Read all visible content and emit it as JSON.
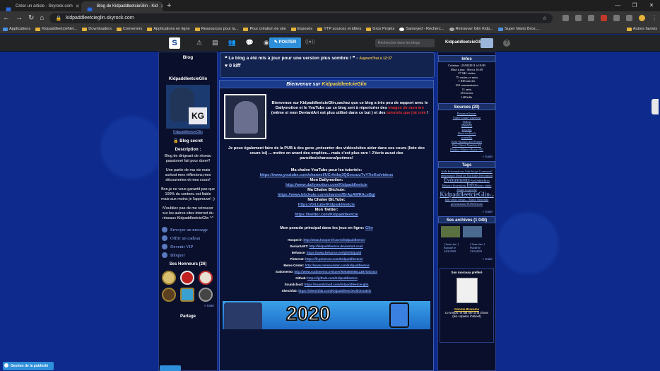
{
  "browser": {
    "tabs": [
      {
        "title": "Créer un article - Skyrock.com",
        "active": false
      },
      {
        "title": "Blog de KidpaddleetcieGlin - Kid",
        "active": true
      }
    ],
    "url": "kidpaddleetcieglin.skyrock.com",
    "bookmarks": [
      "Applications",
      "KidpaddleetcieNet...",
      "Downloaders",
      "Converters",
      "Applications en ligne",
      "Ressources pour la...",
      "Pour création de site",
      "Exposés",
      "YTP sources et idées",
      "Gros Projets",
      "Samoyed - Recherc...",
      "Retrouver Glin Kidp...",
      "Super Mario Bros:..."
    ],
    "bookmarks_right": "Autres favoris"
  },
  "skyrock": {
    "logo": "S",
    "poster": "POSTER",
    "search_placeholder": "Rechercher dans les blogs",
    "username": "KidpaddleetcieGlin",
    "badge": "10"
  },
  "left": {
    "title": "Blog",
    "username": "KidpaddleetcieGlin",
    "profile_link": "KidpaddleetcieGlin",
    "secret": "Blog secret",
    "desc_title": "Description :",
    "desc": [
      "Blog de dirigeant de réseau passionné fait pour durer!!",
      "Une partie de ma vie mais surtout mes réflexions,mes découvertes et mes cours!",
      "Bon,je ne vous garantit pas que 100% du contenu est fiable mais aux moins je l'approuve! ;)",
      "N'oubliez pas de me retrouver sur les autres sites internet du réseaux KidpaddleetcieGlin ^^"
    ],
    "actions": [
      "Envoyer un message",
      "Offrir un cadeau",
      "Devenir VIP",
      "Bloquer"
    ],
    "honors": "Ses Honneurs (26)",
    "suite": "» Suite",
    "partage": "Partage"
  },
  "banner": {
    "title": "Le blog a été mis à jour pour une version plus sombre !",
    "date": "Aujourd'hui à 12:37",
    "kiff": "0 kiff"
  },
  "main": {
    "header_prefix": "Bienvenue sur ",
    "header_name": "KidpaddleetcieGlin",
    "intro": {
      "text": "Bienvenue sur KidpaddleetcieGlin,sachez que ce blog a très peu de rapport avec le Dailymotion et le YouTube car ce blog sert à répertorier des",
      "red1": "images de mon ère",
      "text2": "(même si mon DeviantArt est plus utilisé dans ce but ) et des",
      "red2": "tutoriels que j'ai créé",
      "text3": "!"
    },
    "para": "Je peux également faire de la PUB à des gens ,présenter des vidéos/sites aider dans ses cours (liste des cours ici) ... mettre en avant des emplées... mais c'est plus rare ! J'écris aussi des parodies/chansons/poèmes!",
    "links": [
      {
        "label": "Ma chaîne YouTube pour les tutoriels:",
        "url": "https://www.youtube.com/channel/UCrfetkq3QSoszuuTvY7isKw/videos"
      },
      {
        "label": "Mon Dailymotion:",
        "url": "http://www.dailymotion.com/Kidpaddleetcie"
      },
      {
        "label": "Ma Chaîne Bitchute:",
        "url": "https://www.bitchute.com/channel/BrApAWRAceBg/"
      },
      {
        "label": "Ma Chaîne Bit.Tube:",
        "url": "https://bit.tube/Kidpaddleetcie"
      },
      {
        "label": "Mon Twitter:",
        "url": "https://twitter.com/Kidpaddleetcie"
      }
    ],
    "pseudo": "Mon pseudo principal dans les jeux en ligne:",
    "pseudo_name": "Glin",
    "others": [
      {
        "label": "Hooper.fr:",
        "url": "http://www.hooper.fr/users/kidpaddleetcie"
      },
      {
        "label": "DeviantART:",
        "url": "http://kidpaddleetcie.deviantart.com/"
      },
      {
        "label": "Behance:",
        "url": "https://www.behance.net/glinkidpadd"
      },
      {
        "label": "Pinterest:",
        "url": "https://fr.pinterest.com/Kidpaddleetcie/"
      },
      {
        "label": "Meme Center:",
        "url": "http://www.memecenter.com/kidpaddleetcie"
      },
      {
        "label": "Sudomemo:",
        "url": "http://www.sudomemo.net/user/9063E6085113B7D8@DS"
      },
      {
        "label": "Github:",
        "url": "https://github.com/Kidpaddleetcie"
      },
      {
        "label": "Soundcloud:",
        "url": "https://soundcloud.com/kidpaddleetcie-glin"
      },
      {
        "label": "Sketchfab:",
        "url": "https://sketchfab.com/KidpaddleetcieGlin/models"
      }
    ],
    "banner_year": "2020"
  },
  "right": {
    "info_title": "Infos",
    "info": [
      "Création : 23/08/2011 à 19:09",
      "Mise à jour : Hier à 16:49",
      "37 944 visites",
      "75 visites ce mois",
      "1 848 articles",
      "163 commentaires",
      "11 amis",
      "20 favoris",
      "148 kiffs"
    ],
    "sources_title": "Sources (20)",
    "sources": [
      "BonanzaGamer",
      "Video-Game-Universe",
      "Tidbits",
      "Mania54",
      "kiwidsg",
      "films-exclusifs",
      "sonesflix",
      "Kids-Studios-and-Fisher",
      "Fire-Ghost-Number-42",
      "Photos--Mario--Bross--9G"
    ],
    "suite": "» Suite",
    "tags_title": "Tags",
    "tags_small": "Aide Informations Aide blogs Comment? annonation Dead on YouTube Decoration",
    "tags_mid": "Événements",
    "tags_small2": "FanDiddleBros Histoire Inventions",
    "tags_big": "Infos",
    "tags_small3": "jeux vidéo Jesper lo proche",
    "tags_big2": "KidpaddleetcieGlin",
    "tags_small4": "Le bon vieux temps... Mario Nintendo présentation PUB Retrolo",
    "archives_title": "Ses archives (1 048)",
    "archives": [
      "[ Sans titre ] Rajouté le 24/4/2018",
      "[ Sans titre ] Publié le 23/6/2018"
    ],
    "fav_title": "Son morceau préféré",
    "fav_name": "Gnome Bracame",
    "fav_desc": "Le temps ne fait rien à la chose (les copains d'abord)"
  },
  "footer": {
    "pub": "Gestion de la publicité"
  }
}
